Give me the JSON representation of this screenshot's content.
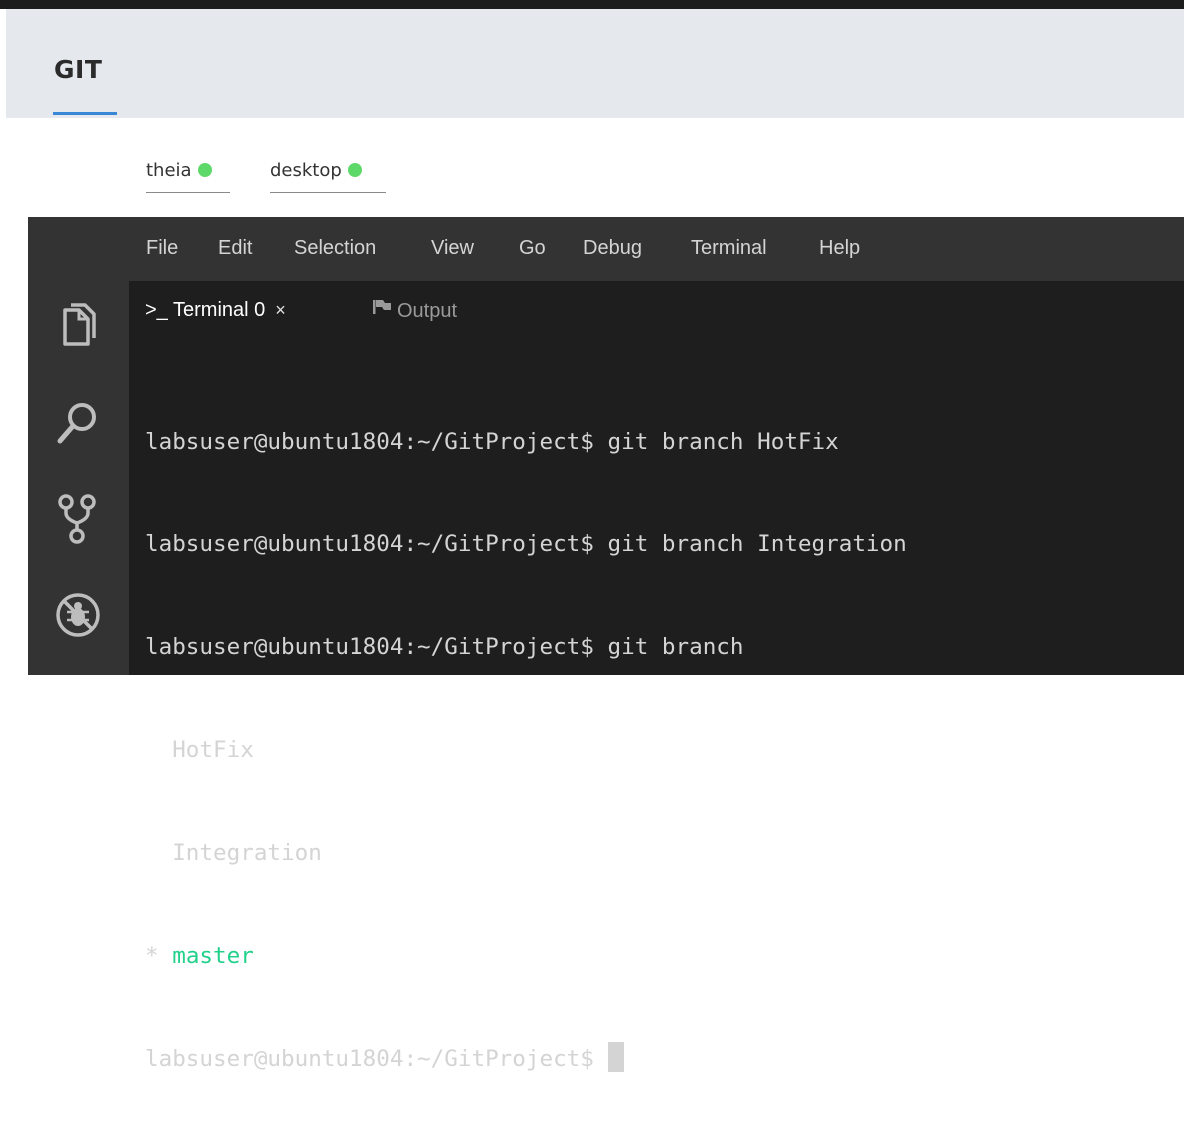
{
  "header": {
    "title": "GIT"
  },
  "env_tabs": [
    {
      "label": "theia",
      "status_color": "#5fd86a"
    },
    {
      "label": "desktop",
      "status_color": "#5fd86a"
    }
  ],
  "menu": [
    "File",
    "Edit",
    "Selection",
    "View",
    "Go",
    "Debug",
    "Terminal",
    "Help"
  ],
  "activity_bar": [
    "files-icon",
    "search-icon",
    "source-control-icon",
    "debug-icon"
  ],
  "panel": {
    "terminal_tab": {
      "prompt_icon": ">_",
      "label": "Terminal 0",
      "close": "×"
    },
    "output_tab": {
      "icon": "flag-icon",
      "label": "Output"
    }
  },
  "terminal": {
    "lines": [
      "labsuser@ubuntu1804:~/GitProject$ git branch HotFix",
      "labsuser@ubuntu1804:~/GitProject$ git branch Integration",
      "labsuser@ubuntu1804:~/GitProject$ git branch",
      "  HotFix",
      "  Integration"
    ],
    "current_branch_marker": "* ",
    "current_branch": "master",
    "prompt": "labsuser@ubuntu1804:~/GitProject$ "
  },
  "colors": {
    "accent": "#3a87d6",
    "status_dot": "#5fd86a",
    "current_branch": "#23d18b",
    "terminal_bg": "#1e1e1e"
  }
}
